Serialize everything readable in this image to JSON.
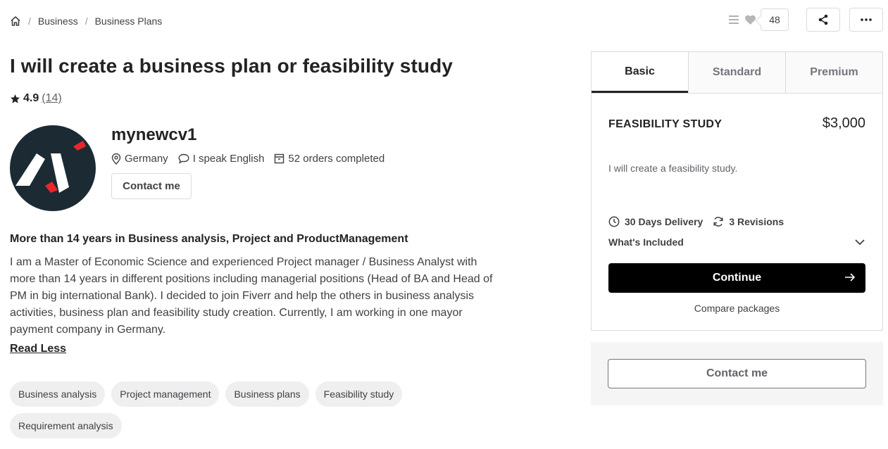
{
  "breadcrumb": {
    "items": [
      "Business",
      "Business Plans"
    ],
    "separator": "/"
  },
  "top_actions": {
    "likes_count": "48"
  },
  "gig": {
    "title": "I will create a business plan or feasibility study",
    "rating": "4.9",
    "rating_count": "(14)"
  },
  "seller": {
    "name": "mynewcv1",
    "country": "Germany",
    "language": "I speak English",
    "orders": "52 orders completed",
    "contact_label": "Contact me"
  },
  "about": {
    "heading": "More than 14 years in Business analysis, Project and ProductManagement",
    "text": "I am a Master of Economic Science and experienced Project manager / Business Analyst with more than 14 years in different positions including managerial positions (Head of BA and Head of PM in big international Bank). I decided to join Fiverr and help the others in business analysis activities, business plan and feasibility study creation. Currently, I am working in one mayor payment company in Germany.",
    "read_less": "Read Less"
  },
  "tags": [
    "Business analysis",
    "Project management",
    "Business plans",
    "Feasibility study",
    "Requirement analysis"
  ],
  "package": {
    "tabs": [
      "Basic",
      "Standard",
      "Premium"
    ],
    "active_tab": "Basic",
    "name": "FEASIBILITY STUDY",
    "price": "$3,000",
    "description": "I will create a feasibility study.",
    "delivery": "30 Days Delivery",
    "revisions": "3 Revisions",
    "whats_included": "What's Included",
    "continue_label": "Continue",
    "compare_label": "Compare packages"
  },
  "contact_panel": {
    "label": "Contact me"
  },
  "colors": {
    "text": "#222325",
    "muted": "#62646a",
    "border": "#dadbdd",
    "button": "#000000",
    "tag_bg": "#efeff0",
    "avatar_bg": "#1c2b33",
    "avatar_accent": "#e8272b"
  }
}
